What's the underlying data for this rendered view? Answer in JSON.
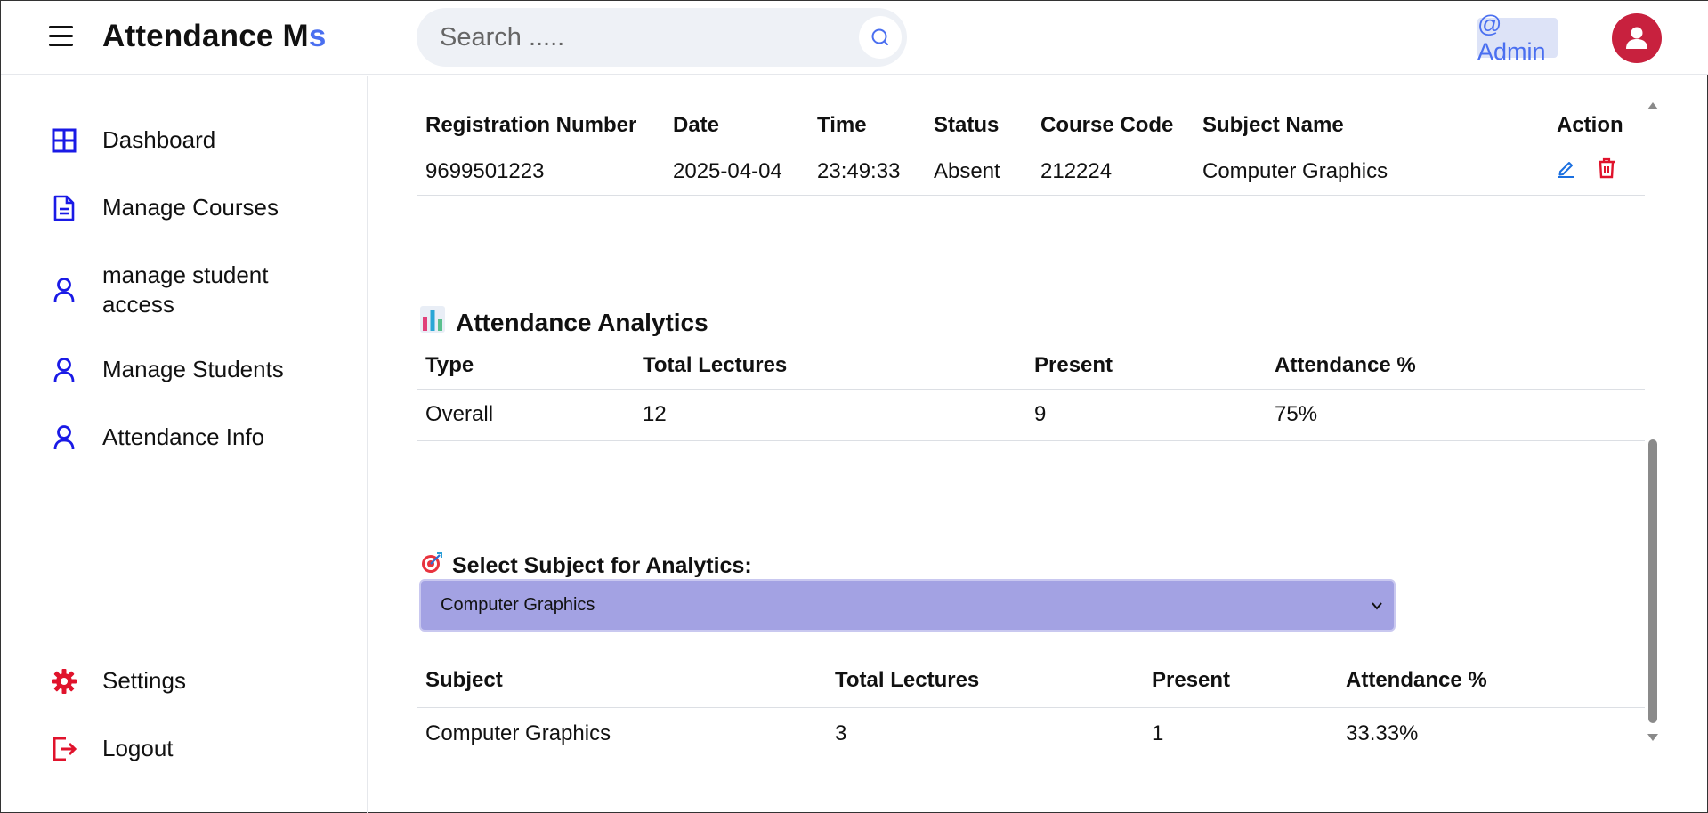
{
  "header": {
    "brand_main": "Attendance M",
    "brand_accent": "s",
    "search_placeholder": "Search .....",
    "admin_label": "@ Admin"
  },
  "sidebar": {
    "items": [
      {
        "label": "Dashboard",
        "icon": "grid-icon"
      },
      {
        "label": "Manage Courses",
        "icon": "document-icon"
      },
      {
        "label": "manage student access",
        "icon": "user-icon"
      },
      {
        "label": "Manage Students",
        "icon": "user-icon"
      },
      {
        "label": "Attendance Info",
        "icon": "user-icon"
      }
    ],
    "bottom_items": [
      {
        "label": "Settings",
        "icon": "gear-icon"
      },
      {
        "label": "Logout",
        "icon": "logout-icon"
      }
    ]
  },
  "records": {
    "headers": [
      "Registration Number",
      "Date",
      "Time",
      "Status",
      "Course Code",
      "Subject Name",
      "Action"
    ],
    "rows": [
      {
        "reg": "9699501223",
        "date": "2025-04-04",
        "time": "23:49:33",
        "status": "Absent",
        "code": "212224",
        "subject": "Computer Graphics"
      }
    ]
  },
  "analytics": {
    "title": "Attendance Analytics",
    "icon": "bar-chart-emoji",
    "headers": [
      "Type",
      "Total Lectures",
      "Present",
      "Attendance %"
    ],
    "rows": [
      {
        "type": "Overall",
        "total": "12",
        "present": "9",
        "pct": "75%"
      }
    ]
  },
  "subject_select": {
    "label": "Select Subject for Analytics:",
    "icon": "target-emoji",
    "selected": "Computer Graphics"
  },
  "subject_analytics": {
    "headers": [
      "Subject",
      "Total Lectures",
      "Present",
      "Attendance %"
    ],
    "rows": [
      {
        "subject": "Computer Graphics",
        "total": "3",
        "present": "1",
        "pct": "33.33%"
      }
    ]
  },
  "colors": {
    "accent": "#4a6ff0",
    "nav_icon": "#1a1ae6",
    "danger_icon": "#e0132c",
    "select_bg": "#a3a2e3",
    "avatar_bg": "#c8213e"
  }
}
